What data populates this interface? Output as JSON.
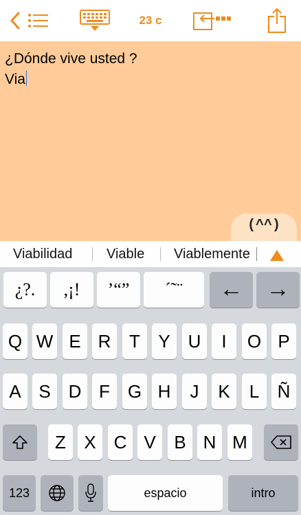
{
  "toolbar": {
    "char_count": "23 c",
    "icons": [
      "back-chevron-icon",
      "list-icon",
      "keyboard-hide-icon",
      "insert-text-icon",
      "share-icon"
    ],
    "accent_color": "#f08a1c"
  },
  "editor": {
    "lines": [
      "¿Dónde vive usted ?",
      "Via"
    ],
    "background_color": "#ffcc99"
  },
  "emoticon_tab": {
    "label": "(^^)"
  },
  "suggestions": {
    "items": [
      "Viabilidad",
      "Viable",
      "Viablemente"
    ],
    "more_icon": "up-triangle-icon"
  },
  "punct_row": [
    "¿?.",
    ",¡!",
    "’“”",
    "´˜¨",
    "←",
    "→"
  ],
  "keyboard": {
    "row1": [
      "Q",
      "W",
      "E",
      "R",
      "T",
      "Y",
      "U",
      "I",
      "O",
      "P"
    ],
    "row2": [
      "A",
      "S",
      "D",
      "F",
      "G",
      "H",
      "J",
      "K",
      "L",
      "Ñ"
    ],
    "row3": [
      "Z",
      "X",
      "C",
      "V",
      "B",
      "N",
      "M"
    ],
    "numbers_label": "123",
    "space_label": "espacio",
    "return_label": "intro",
    "icons": [
      "shift-icon",
      "backspace-icon",
      "globe-icon",
      "microphone-icon"
    ]
  }
}
